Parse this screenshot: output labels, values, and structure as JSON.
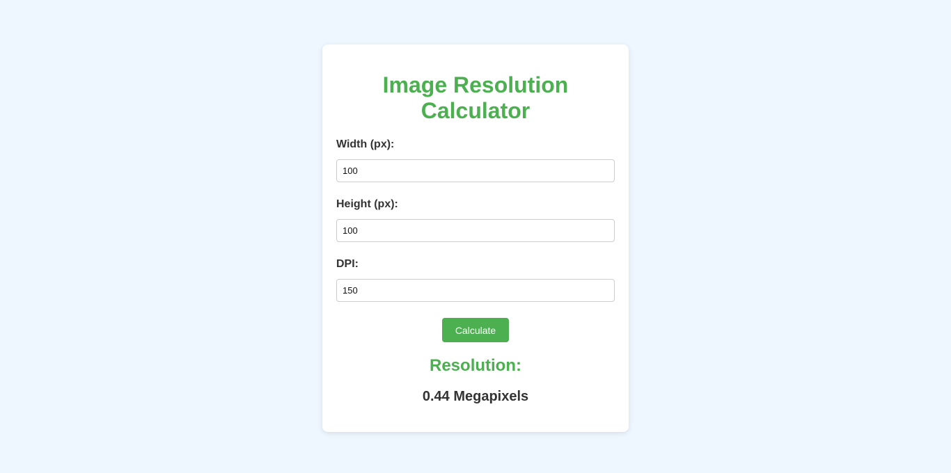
{
  "app": {
    "title": "Image Resolution Calculator",
    "accent_color": "#4caf50",
    "background_color": "#eef6ff"
  },
  "form": {
    "width": {
      "label": "Width (px):",
      "value": "100"
    },
    "height": {
      "label": "Height (px):",
      "value": "100"
    },
    "dpi": {
      "label": "DPI:",
      "value": "150"
    },
    "calculate_label": "Calculate"
  },
  "result": {
    "heading": "Resolution:",
    "value": "0.44 Megapixels"
  }
}
